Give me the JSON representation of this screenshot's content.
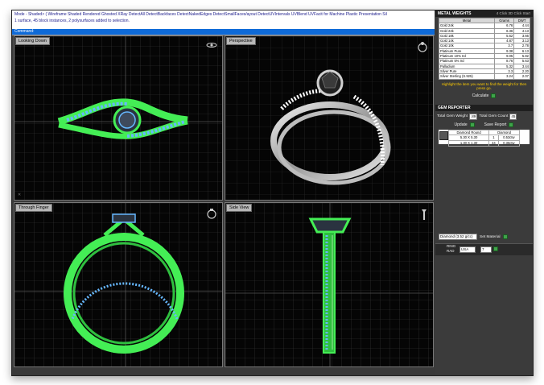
{
  "command": {
    "history": [
      "Mode - Shaded> ( Wireframe  Shaded  Rendered  Ghosted  XRay  DetectAll  DetectBackfaces  DetectNakedEdges  DetectSmallFaces/ayout  DetectUVIntervals  UVBlend  UVFacit  for  Machine  Plastic  Presentation  Sil",
      "1 surface, 45 block instances, 2 polysurfaces added to selection."
    ],
    "prompt": "Command:"
  },
  "viewports": {
    "top_left": {
      "label": "Looking Down"
    },
    "top_right": {
      "label": "Perspective"
    },
    "bottom_left": {
      "label": "Through Finger"
    },
    "bottom_right": {
      "label": "Side View"
    }
  },
  "metal_weights": {
    "title": "METAL WEIGHTS",
    "subtitle": "4 Click 3D Click Start",
    "columns": [
      "Metal",
      "Grams",
      "DWT"
    ],
    "rows": [
      [
        "Gold 24k",
        "6.76",
        "4.44"
      ],
      [
        "Gold 22k",
        "6.36",
        "4.13"
      ],
      [
        "Gold 18k",
        "5.62",
        "3.66"
      ],
      [
        "Gold 14k",
        "4.87",
        "3.13"
      ],
      [
        "Gold 10k",
        "3.7",
        "2.78"
      ],
      [
        "Platinum Pure",
        "9.38",
        "6.13"
      ],
      [
        "Platinum 10% Ird",
        "9.05",
        "5.82"
      ],
      [
        "Platinum 5% Ird",
        "8.76",
        "5.63"
      ],
      [
        "Palladium",
        "5.32",
        "3.44"
      ],
      [
        "Silver Pure",
        "3.3",
        "2.20"
      ],
      [
        "Silver Sterling (S.925)",
        "3.24",
        "2.07"
      ]
    ],
    "hint": "Highlight the item you want to find the weight for then press go.",
    "calculate_label": "Calculate"
  },
  "gem_reporter": {
    "title": "GEM REPORTER",
    "total_weight_label": "Total Gem Weight",
    "total_weight_value": ".89",
    "total_count_label": "Total Gem Count",
    "total_count_value": "45",
    "update_label": "Update",
    "save_report_label": "Save Report",
    "table_header": [
      "Diamond Round",
      "Diamond"
    ],
    "rows": [
      [
        "5.30 X 5.30",
        "1",
        "0.53ctw"
      ],
      [
        "1.30 X 1.30",
        "44",
        "0.36ctw"
      ]
    ],
    "material_select": "Diamond   (3.52 g/cc)",
    "set_material_label": "Set Material"
  },
  "ring_size": {
    "labels": [
      "RING",
      "RAD"
    ],
    "system": "USA",
    "value": "7"
  }
}
